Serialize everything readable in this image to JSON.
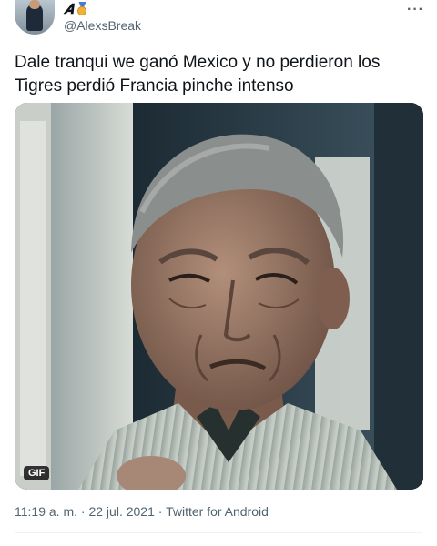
{
  "tweet": {
    "display_name": "𝑨",
    "handle": "@AlexsBreak",
    "text": "Dale tranqui we ganó Mexico y no perdieron los Tigres perdió Francia pinche intenso",
    "media_badge": "GIF",
    "time": "11:19 a. m.",
    "separator": " · ",
    "date": "22 jul. 2021",
    "source": "Twitter for Android"
  },
  "icons": {
    "more": "more-horizontal-icon",
    "verified_medal": "medal-icon"
  },
  "colors": {
    "text_primary": "#0f1419",
    "text_secondary": "#536471",
    "divider": "#eff3f4"
  }
}
